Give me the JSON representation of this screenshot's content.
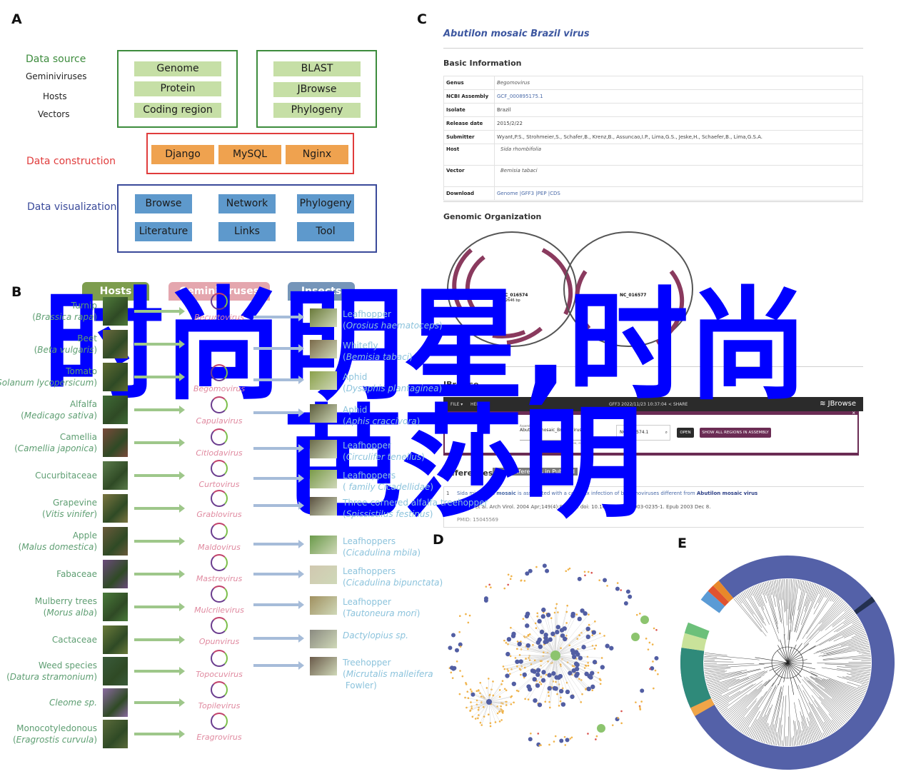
{
  "panels": {
    "a": "A",
    "b": "B",
    "c": "C",
    "d": "D",
    "e": "E"
  },
  "panel_a": {
    "labels": {
      "data_source": "Data source",
      "geminiviruses": "Geminiviruses",
      "hosts": "Hosts",
      "vectors": "Vectors",
      "data_construction": "Data construction",
      "data_visualization": "Data visualization"
    },
    "source_box_1": [
      "Genome",
      "Protein",
      "Coding region"
    ],
    "source_box_2": [
      "BLAST",
      "JBrowse",
      "Phylogeny"
    ],
    "construction": [
      "Django",
      "MySQL",
      "Nginx"
    ],
    "visualization": [
      "Browse",
      "Network",
      "Phylogeny",
      "Literature",
      "Links",
      "Tool"
    ],
    "colors": {
      "source": "#3d8c3d",
      "construction": "#e03c3c",
      "visualization": "#3a4a9a"
    }
  },
  "panel_b": {
    "headers": {
      "hosts": "Hosts",
      "geminiviruses": "Geminiviruses",
      "insects": "Insects"
    },
    "hosts": [
      {
        "common": "Turnip",
        "latin": "Brassica rapa"
      },
      {
        "common": "Beet",
        "latin": "Beta vulgaris"
      },
      {
        "common": "Tomato",
        "latin": "Solanum lycopersicum"
      },
      {
        "common": "Alfalfa",
        "latin": "Medicago sativa"
      },
      {
        "common": "Camellia",
        "latin": "Camellia japonica"
      },
      {
        "common": "Cucurbitaceae",
        "latin": ""
      },
      {
        "common": "Grapevine",
        "latin": "Vitis vinifer"
      },
      {
        "common": "Apple",
        "latin": "Malus domestica"
      },
      {
        "common": "Fabaceae",
        "latin": ""
      },
      {
        "common": "Mulberry trees",
        "latin": "Morus alba"
      },
      {
        "common": "Cactaceae",
        "latin": ""
      },
      {
        "common": "Weed species",
        "latin": "Datura stramonium"
      },
      {
        "common": "",
        "latin": "Cleome sp."
      },
      {
        "common": "Monocotyledonous",
        "latin": "Eragrostis curvula"
      }
    ],
    "viruses": [
      "Becurtovirus",
      "Begomovirus",
      "Capulavirus",
      "Citlodavirus",
      "Curtovirus",
      "Grablovirus",
      "Maldovirus",
      "Mastrevirus",
      "Mulcrilevirus",
      "Opunvirus",
      "Topocuvirus",
      "Topilevirus",
      "Eragrovirus"
    ],
    "insects": [
      {
        "common": "Leafhopper",
        "latin": "Orosius haematoceps"
      },
      {
        "common": "Whitefly",
        "latin": "Bemisia tabaci"
      },
      {
        "common": "Aphid",
        "latin": "Dysaphis plantaginea"
      },
      {
        "common": "Aphid",
        "latin": "Aphis craccivora"
      },
      {
        "common": "Leafhopper",
        "latin": "Circulifer tenellus"
      },
      {
        "common": "Leafhoppers",
        "latin": " family Cicadellidae"
      },
      {
        "common": "Three-cornered alfalfa treehopper",
        "latin": "Spissistilus festinus"
      },
      {
        "common": "Leafhoppers",
        "latin": "Cicadulina mbila"
      },
      {
        "common": "Leafhoppers",
        "latin": "Cicadulina bipunctata"
      },
      {
        "common": "Leafhopper",
        "latin": "Tautoneura mori"
      },
      {
        "common": "",
        "latin": "Dactylopius sp."
      },
      {
        "common": "Treehopper",
        "latin": "Micrutalis malleifera",
        "extra": "Fowler)"
      }
    ]
  },
  "panel_c": {
    "title": "Abutilon mosaic Brazil virus",
    "basic_info_heading": "Basic Information",
    "rows": [
      {
        "key": "Genus",
        "value": "Begomovirus",
        "style": "it"
      },
      {
        "key": "NCBI Assembly",
        "value": "GCF_000895175.1",
        "style": "link"
      },
      {
        "key": "Isolate",
        "value": "Brazil",
        "style": "v"
      },
      {
        "key": "Release date",
        "value": "2015/2/22",
        "style": "v"
      },
      {
        "key": "Submitter",
        "value": "Wyant,P.S., Strohmeier,S., Schafer,B., Krenz,B., Assuncao,I.P., Lima,G.S., Jeske,H., Schaefer,B., Lima,G.S.A.",
        "style": "v"
      },
      {
        "key": "Host",
        "value": "Sida rhombifolia",
        "style": "it link"
      },
      {
        "key": "Vector",
        "value": "Bemisia tabaci",
        "style": "it link"
      },
      {
        "key": "Download",
        "value": "Genome |GFF3 |PEP |CDS",
        "style": "link"
      }
    ],
    "genomic_heading": "Genomic Organization",
    "genomes": [
      {
        "id": "NC_016574",
        "size": "2646 bp"
      },
      {
        "id": "NC_016577",
        "size": ""
      }
    ],
    "browse_heading": "JBrowse",
    "jbrowse": {
      "menu_file": "FILE ▾",
      "menu_help": "HELP ▾",
      "session": "GFF3 2022/11/23 10:37:04",
      "share": "SHARE",
      "brand": "JBrowse",
      "assembly_label": "Assembly",
      "assembly_value": "Abutilon_mosaic_Brazil_virus",
      "locus_value": "NC_016574.1",
      "hint": "Select assembly to view, enter a sequence or location",
      "open": "OPEN",
      "show_all": "SHOW ALL REGIONS IN ASSEMBLY",
      "close": "×"
    },
    "references_heading": "References",
    "references_button": "More References in PubMed",
    "references": [
      {
        "num": "1",
        "title_pre": "Sida micrantha ",
        "title_bold1": "mosaic",
        "title_mid": " is associated with a complex infection of begomoviruses different from ",
        "title_bold2": "Abutilon mosaic virus",
        "citation": "Jovel J, et al. Arch Virol. 2004 Apr;149(4):829-41. doi: 10.1007/s00705-003-0235-1. Epub 2003 Dec 8.",
        "pmid": "PMID: 15045569"
      }
    ]
  },
  "panel_d": {
    "description": "Network of geminiviruses, hosts and vectors"
  },
  "panel_e": {
    "description": "Circular phylogenetic tree"
  },
  "watermark": {
    "line1": "时尚明星,时尚",
    "line2": "芭莎明",
    "color": "#0000ff"
  }
}
